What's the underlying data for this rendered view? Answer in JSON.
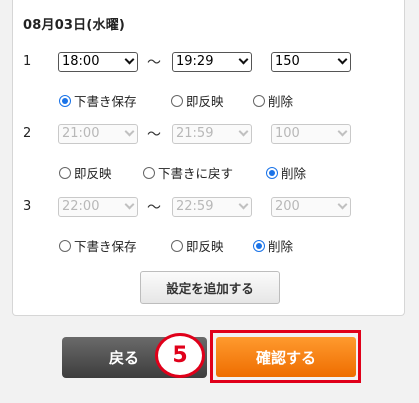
{
  "date_heading": "08月03日(水曜)",
  "rows": [
    {
      "index": "1",
      "start": "18:00",
      "end": "19:29",
      "amount": "150",
      "tilde": "～",
      "options": [
        {
          "label": "下書き保存",
          "selected": true
        },
        {
          "label": "即反映",
          "selected": false
        },
        {
          "label": "削除",
          "selected": false
        }
      ]
    },
    {
      "index": "2",
      "start": "21:00",
      "end": "21:59",
      "amount": "100",
      "tilde": "～",
      "options": [
        {
          "label": "即反映",
          "selected": false
        },
        {
          "label": "下書きに戻す",
          "selected": false
        },
        {
          "label": "削除",
          "selected": true
        }
      ]
    },
    {
      "index": "3",
      "start": "22:00",
      "end": "22:59",
      "amount": "200",
      "tilde": "～",
      "options": [
        {
          "label": "下書き保存",
          "selected": false
        },
        {
          "label": "即反映",
          "selected": false
        },
        {
          "label": "削除",
          "selected": true
        }
      ]
    }
  ],
  "add_setting_label": "設定を追加する",
  "back_label": "戻る",
  "confirm_label": "確認する",
  "step_marker": "5",
  "colors": {
    "accent_orange": "#f07800",
    "highlight_red": "#e0001a",
    "radio_blue": "#1a73e8"
  }
}
